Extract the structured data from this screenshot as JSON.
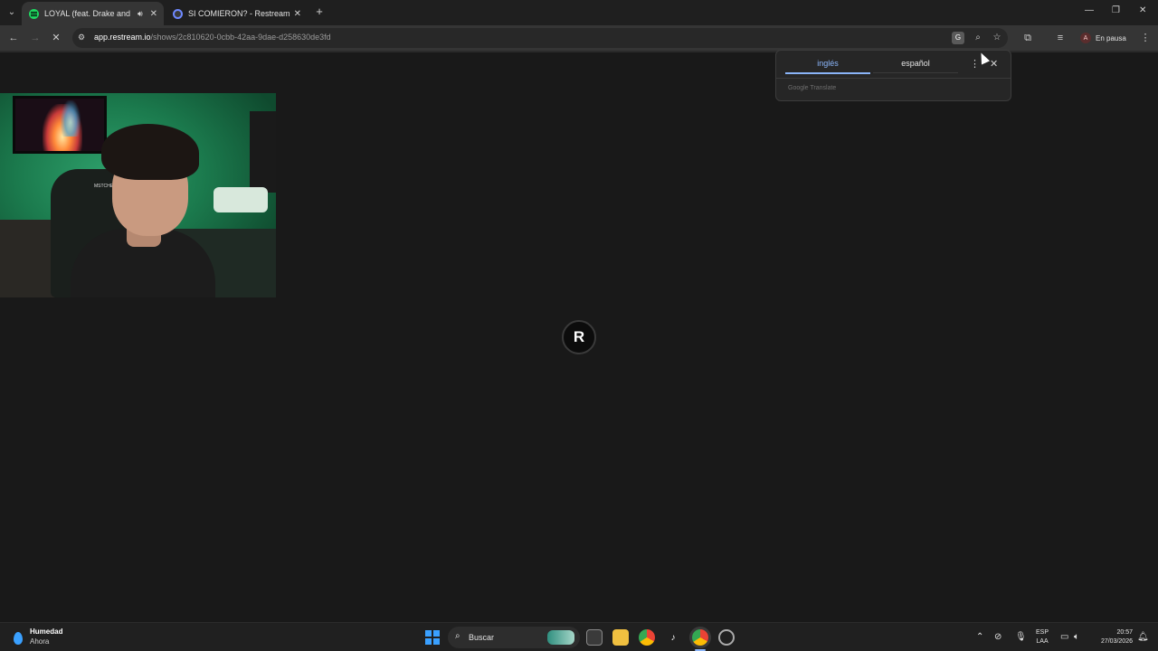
{
  "tabs": [
    {
      "title": "LOYAL (feat. Drake and Bad Bunny)",
      "active": true,
      "audio": true
    },
    {
      "title": "SI COMIERON? - Restream",
      "active": false
    }
  ],
  "address": {
    "host": "app.restream.io",
    "path": "/shows/2c810620-0cbb-42aa-9dae-d258630de3fd"
  },
  "profile": {
    "initial": "A",
    "label": "En pausa"
  },
  "translate": {
    "source_lang": "inglés",
    "target_lang": "español",
    "footer": "Google Translate"
  },
  "webcam": {
    "chair_tag": "MSTCHEL"
  },
  "loader": {
    "letter": "R"
  },
  "taskbar": {
    "weather_title": "Humedad",
    "weather_sub": "Ahora",
    "search_placeholder": "Buscar",
    "lang_top": "ESP",
    "lang_bottom": "LAA",
    "time": "20:57",
    "date": "27/03/2026"
  },
  "colors": {
    "accent": "#8ab4f8",
    "spotify": "#1ed760",
    "page_bg": "#191919"
  }
}
